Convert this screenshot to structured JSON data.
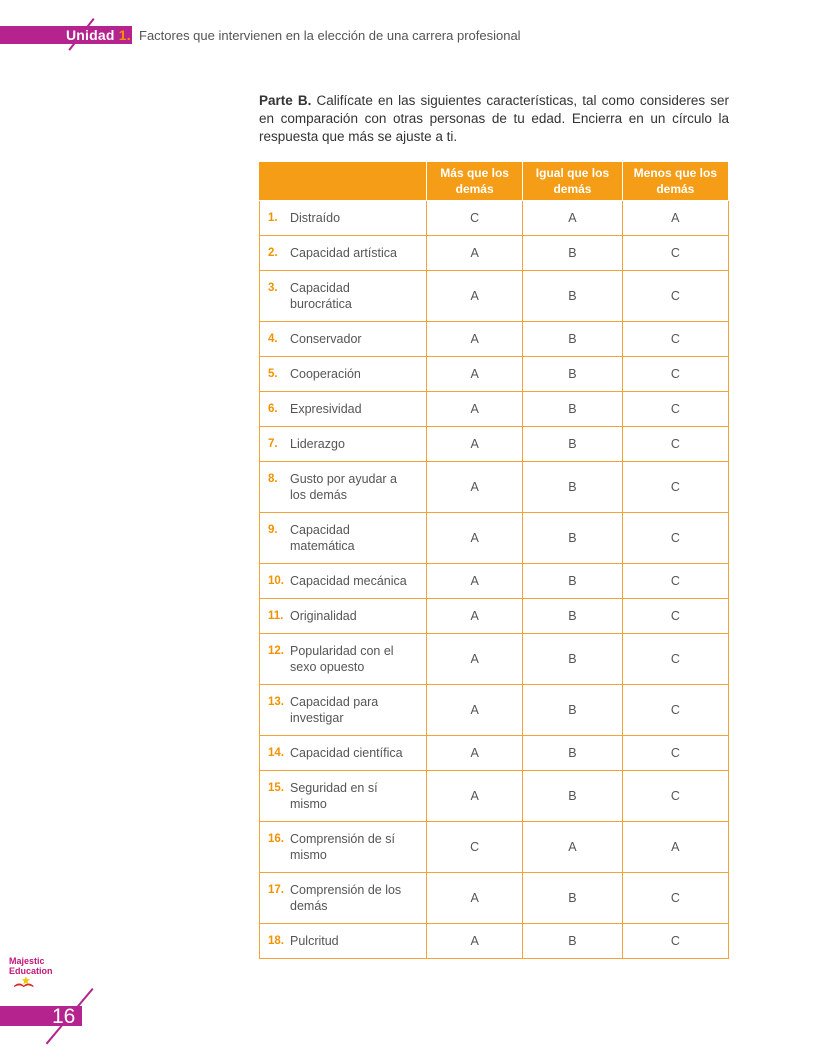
{
  "header": {
    "unit_label": "Unidad",
    "unit_number": "1.",
    "title": "Factores que intervienen en la elección de una carrera profesional"
  },
  "intro": {
    "lead": "Parte B.",
    "text": "Califícate en las siguientes características, tal como consideres ser en comparación con otras personas de tu edad. Encierra en un círculo la respuesta que más se ajuste a ti."
  },
  "table": {
    "columns": [
      "Más que los demás",
      "Igual que los demás",
      "Menos que los demás"
    ],
    "rows": [
      {
        "num": "1.",
        "label": "Distraído",
        "a": "C",
        "b": "A",
        "c": "A"
      },
      {
        "num": "2.",
        "label": "Capacidad artística",
        "a": "A",
        "b": "B",
        "c": "C"
      },
      {
        "num": "3.",
        "label": "Capacidad burocrática",
        "a": "A",
        "b": "B",
        "c": "C"
      },
      {
        "num": "4.",
        "label": "Conservador",
        "a": "A",
        "b": "B",
        "c": "C"
      },
      {
        "num": "5.",
        "label": "Cooperación",
        "a": "A",
        "b": "B",
        "c": "C"
      },
      {
        "num": "6.",
        "label": "Expresividad",
        "a": "A",
        "b": "B",
        "c": "C"
      },
      {
        "num": "7.",
        "label": "Liderazgo",
        "a": "A",
        "b": "B",
        "c": "C"
      },
      {
        "num": "8.",
        "label": "Gusto por ayudar a los demás",
        "a": "A",
        "b": "B",
        "c": "C"
      },
      {
        "num": "9.",
        "label": "Capacidad matemática",
        "a": "A",
        "b": "B",
        "c": "C"
      },
      {
        "num": "10.",
        "label": "Capacidad mecánica",
        "a": "A",
        "b": "B",
        "c": "C"
      },
      {
        "num": "11.",
        "label": "Originalidad",
        "a": "A",
        "b": "B",
        "c": "C"
      },
      {
        "num": "12.",
        "label": "Popularidad con el sexo opuesto",
        "a": "A",
        "b": "B",
        "c": "C"
      },
      {
        "num": "13.",
        "label": "Capacidad para investigar",
        "a": "A",
        "b": "B",
        "c": "C"
      },
      {
        "num": "14.",
        "label": "Capacidad científica",
        "a": "A",
        "b": "B",
        "c": "C"
      },
      {
        "num": "15.",
        "label": "Seguridad en sí mismo",
        "a": "A",
        "b": "B",
        "c": "C"
      },
      {
        "num": "16.",
        "label": "Comprensión de sí mismo",
        "a": "C",
        "b": "A",
        "c": "A"
      },
      {
        "num": "17.",
        "label": "Comprensión de los demás",
        "a": "A",
        "b": "B",
        "c": "C"
      },
      {
        "num": "18.",
        "label": "Pulcritud",
        "a": "A",
        "b": "B",
        "c": "C"
      }
    ]
  },
  "footer": {
    "logo_line1": "Majestic",
    "logo_line2": "Education",
    "page_number": "16"
  },
  "colors": {
    "magenta": "#b5238e",
    "orange": "#f59d16"
  }
}
